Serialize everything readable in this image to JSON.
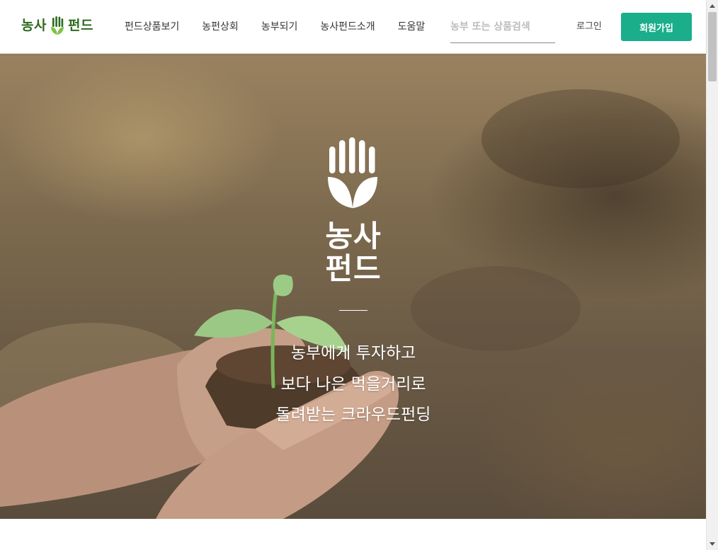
{
  "header": {
    "logo": {
      "left_text": "농사",
      "right_text": "펀드"
    },
    "nav": [
      {
        "label": "펀드상품보기"
      },
      {
        "label": "농펀상회"
      },
      {
        "label": "농부되기"
      },
      {
        "label": "농사펀드소개"
      },
      {
        "label": "도움말"
      }
    ],
    "search": {
      "placeholder": "농부 또는 상품검색",
      "value": ""
    },
    "login_label": "로그인",
    "signup_label": "회원가입"
  },
  "hero": {
    "logo_line1": "농사",
    "logo_line2": "펀드",
    "tagline": [
      "농부에게 투자하고",
      "보다 나은 먹을거리로",
      "돌려받는 크라우드펀딩"
    ]
  },
  "colors": {
    "brand_green": "#2d6a1f",
    "accent_teal": "#1aae8b",
    "text_dark": "#333333",
    "placeholder_gray": "#bdbdbd"
  },
  "icons": {
    "logo_mark": "hand-leaf-icon",
    "hero_mark": "hand-leaf-icon",
    "scroll_up": "arrow-up-icon",
    "scroll_down": "arrow-down-icon"
  }
}
